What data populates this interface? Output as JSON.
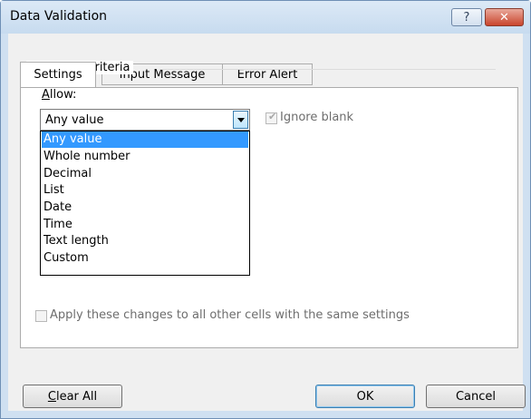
{
  "window": {
    "title": "Data Validation",
    "help_glyph": "?",
    "close_glyph": "✕"
  },
  "tabs": [
    {
      "label": "Settings",
      "active": true
    },
    {
      "label": "Input Message",
      "active": false
    },
    {
      "label": "Error Alert",
      "active": false
    }
  ],
  "criteria": {
    "group_label": "Validation criteria",
    "allow_label_first": "A",
    "allow_label_rest": "llow:",
    "allow_value": "Any value",
    "options": [
      "Any value",
      "Whole number",
      "Decimal",
      "List",
      "Date",
      "Time",
      "Text length",
      "Custom"
    ],
    "selected_index": 0,
    "ignore_blank_label": "Ignore blank",
    "ignore_blank_checked": true,
    "ignore_blank_enabled": false
  },
  "apply_all": {
    "label": "Apply these changes to all other cells with the same settings",
    "checked": false,
    "enabled": false
  },
  "buttons": {
    "clear_all_first": "C",
    "clear_all_rest": "lear All",
    "ok": "OK",
    "cancel": "Cancel"
  },
  "colors": {
    "selection": "#3399ff",
    "title_bar": "#cfe0f1",
    "close_button": "#c9452d"
  }
}
